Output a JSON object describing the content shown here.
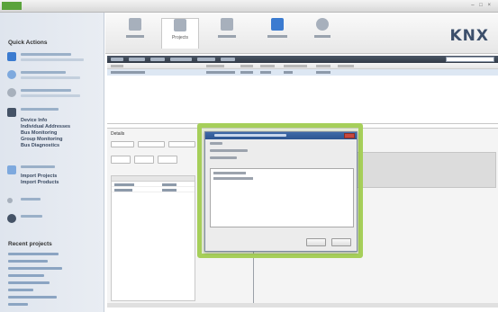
{
  "window": {
    "title_logo": ""
  },
  "sidebar": {
    "quick_actions_heading": "Quick Actions",
    "diagnostics_links": [
      "Device Info",
      "Individual Addresses",
      "Bus Monitoring",
      "Group Monitoring",
      "Bus Diagnostics"
    ],
    "import_links": [
      "Import Projects",
      "Import Products"
    ],
    "recent_heading": "Recent projects"
  },
  "ribbon": {
    "projects_label": "Projects",
    "knx_logo": "KNX"
  },
  "details": {
    "tab_label": "Details"
  },
  "colors": {
    "accent_green": "#a6cf5a",
    "knx_blue": "#3c4f6b"
  }
}
